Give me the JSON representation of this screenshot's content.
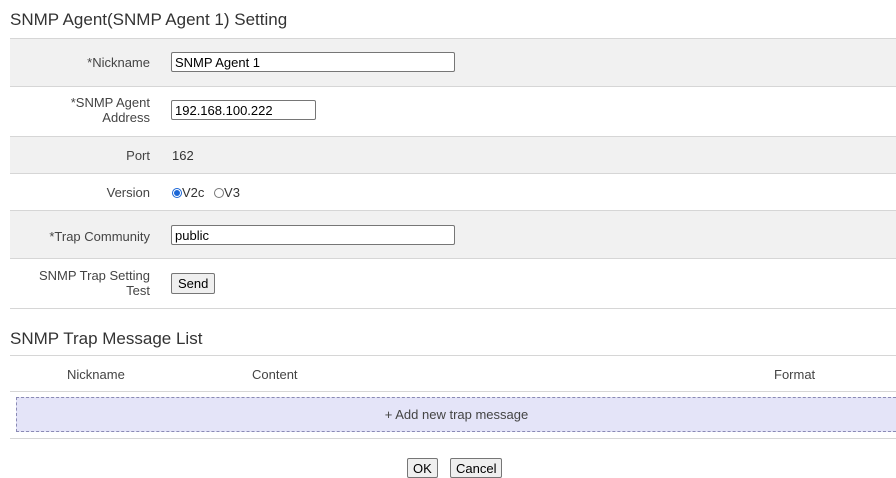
{
  "agent_section": {
    "title": "SNMP Agent(SNMP Agent 1) Setting",
    "nickname": {
      "label": "*Nickname",
      "value": "SNMP Agent 1"
    },
    "address": {
      "label_line1": "*SNMP Agent",
      "label_line2": "Address",
      "value": "192.168.100.222"
    },
    "port": {
      "label": "Port",
      "value": "162"
    },
    "version": {
      "label": "Version",
      "selected": "V2c",
      "options": [
        "V2c",
        "V3"
      ]
    },
    "trap_community": {
      "label": "*Trap Community",
      "value": "public"
    },
    "trap_test": {
      "label_line1": "SNMP Trap Setting",
      "label_line2": "Test",
      "button": "Send"
    }
  },
  "trap_section": {
    "title": "SNMP Trap Message List",
    "columns": [
      "Nickname",
      "Content",
      "Format"
    ],
    "add_label": "+ Add new trap message"
  },
  "footer": {
    "ok": "OK",
    "cancel": "Cancel"
  }
}
